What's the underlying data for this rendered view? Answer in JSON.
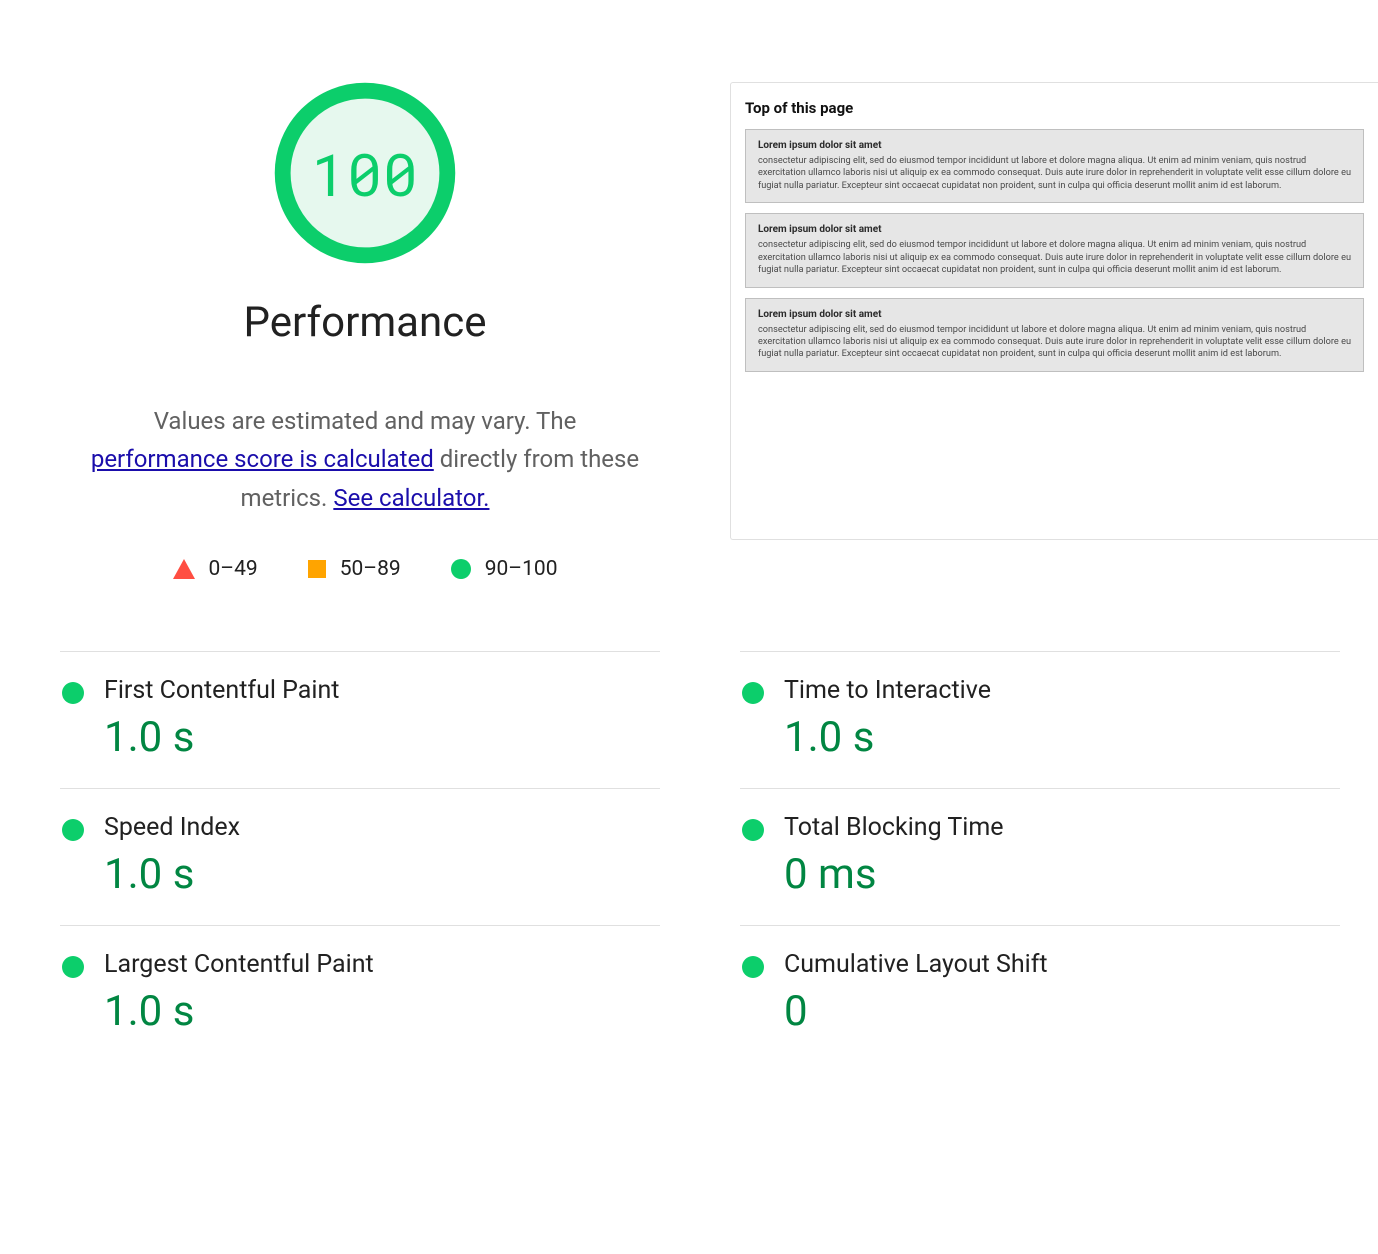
{
  "gauge": {
    "score": "100",
    "title": "Performance",
    "ring_color": "#0CCE6B",
    "fill_color": "#e6f8ee"
  },
  "blurb": {
    "pre": "Values are estimated and may vary. The ",
    "link1": "performance score is calculated",
    "mid": " directly from these metrics. ",
    "link2": "See calculator."
  },
  "legend": {
    "fail": "0–49",
    "avg": "50–89",
    "pass": "90–100"
  },
  "preview": {
    "title": "Top of this page",
    "heading": "Lorem ipsum dolor sit amet",
    "body": "consectetur adipiscing elit, sed do eiusmod tempor incididunt ut labore et dolore magna aliqua. Ut enim ad minim veniam, quis nostrud exercitation ullamco laboris nisi ut aliquip ex ea commodo consequat. Duis aute irure dolor in reprehenderit in voluptate velit esse cillum dolore eu fugiat nulla pariatur. Excepteur sint occaecat cupidatat non proident, sunt in culpa qui officia deserunt mollit anim id est laborum."
  },
  "metrics": [
    {
      "name": "First Contentful Paint",
      "value": "1.0 s",
      "status": "pass"
    },
    {
      "name": "Time to Interactive",
      "value": "1.0 s",
      "status": "pass"
    },
    {
      "name": "Speed Index",
      "value": "1.0 s",
      "status": "pass"
    },
    {
      "name": "Total Blocking Time",
      "value": "0 ms",
      "status": "pass"
    },
    {
      "name": "Largest Contentful Paint",
      "value": "1.0 s",
      "status": "pass"
    },
    {
      "name": "Cumulative Layout Shift",
      "value": "0",
      "status": "pass"
    }
  ]
}
